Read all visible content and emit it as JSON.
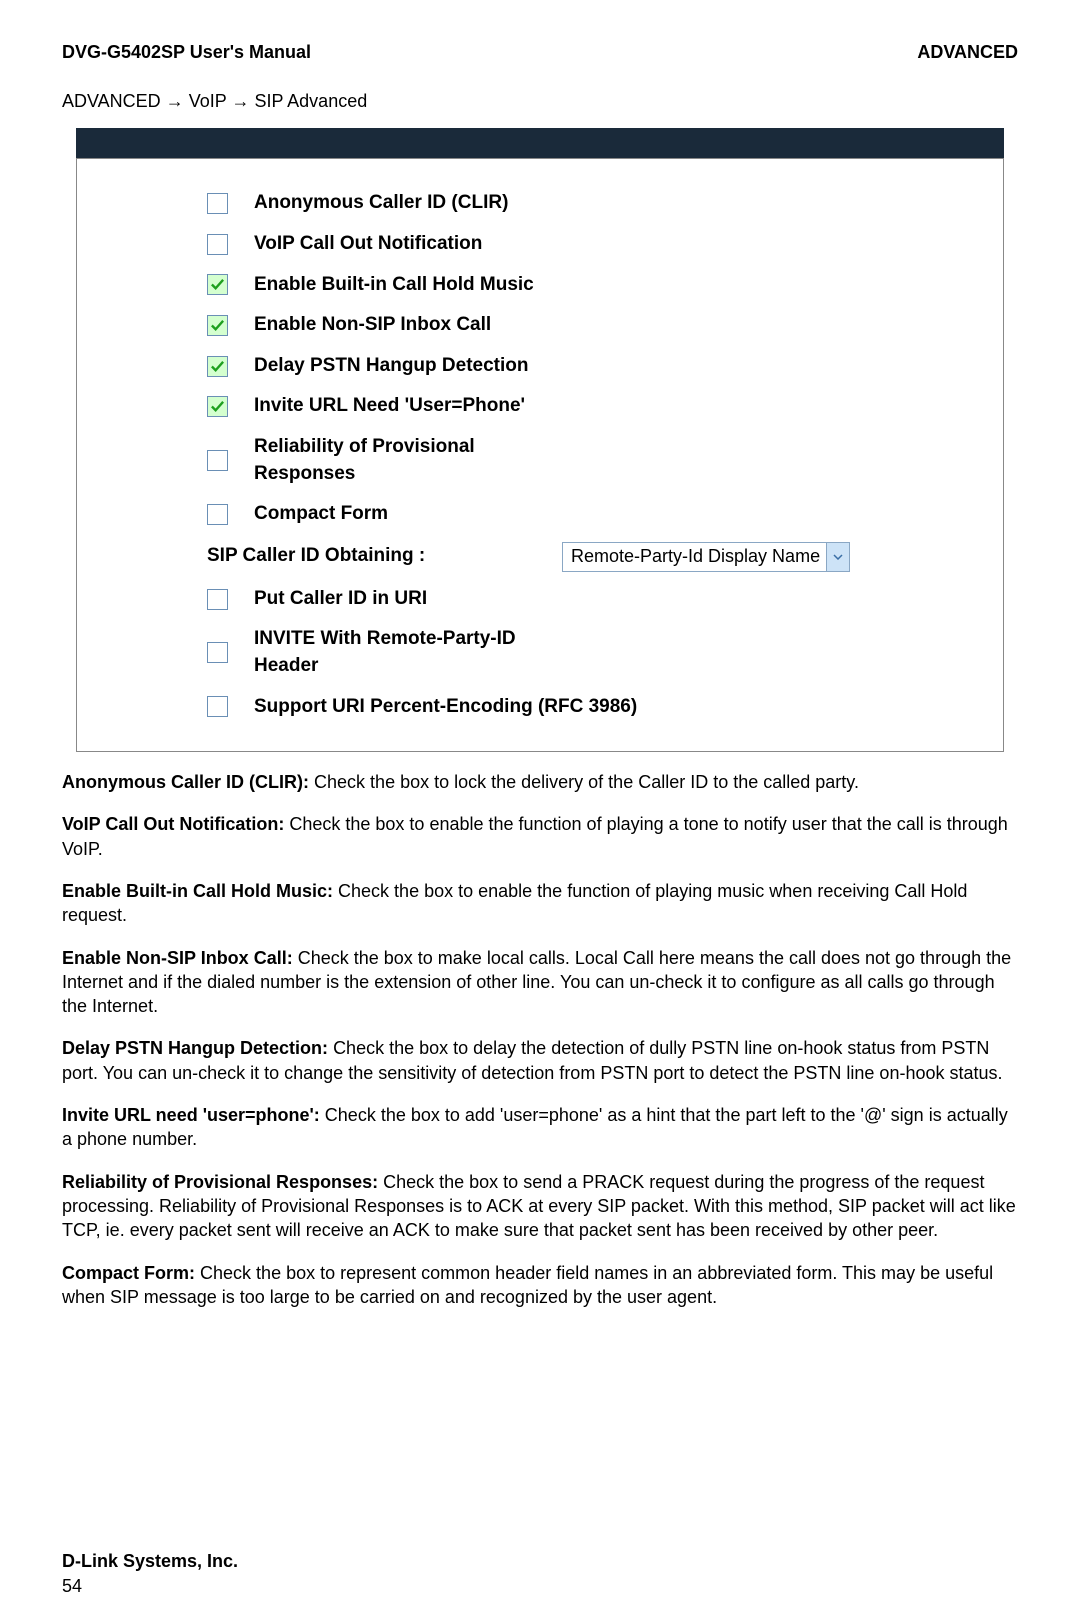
{
  "header": {
    "left": "DVG-G5402SP User's Manual",
    "right": "ADVANCED"
  },
  "crumb": {
    "a": "ADVANCED",
    "b": "VoIP",
    "c": "SIP Advanced"
  },
  "opts": [
    "Anonymous Caller ID (CLIR)",
    "VoIP Call Out Notification",
    "Enable Built-in Call Hold Music",
    "Enable Non-SIP Inbox Call",
    "Delay PSTN Hangup Detection",
    "Invite URL Need 'User=Phone'",
    "Reliability of Provisional Responses",
    "Compact Form",
    "Put Caller ID in URI",
    "INVITE With Remote-Party-ID Header",
    "Support URI Percent-Encoding (RFC 3986)"
  ],
  "selectRow": {
    "label": "SIP Caller ID Obtaining :",
    "value": "Remote-Party-Id Display Name"
  },
  "body": [
    {
      "t": "Anonymous Caller ID (CLIR):",
      "d": "Check the box to lock the delivery of the Caller ID to the called party."
    },
    {
      "t": "VoIP Call Out Notification:",
      "d": "Check the box to enable the function of playing a tone to notify user that the call is through VoIP."
    },
    {
      "t": "Enable Built-in Call Hold Music:",
      "d": "Check the box to enable the function of playing music when receiving Call Hold request."
    },
    {
      "t": "Enable Non-SIP Inbox Call:",
      "d": "Check the box to make local calls. Local Call here means the call does not go through the Internet and if the dialed number is the extension of other line. You can un-check it to configure as all calls go through the Internet."
    },
    {
      "t": "Delay PSTN Hangup Detection:",
      "d": "Check the box to delay the detection of dully PSTN line on-hook status from PSTN port. You can un-check it to change the sensitivity of detection from PSTN port to detect the PSTN line on-hook status."
    },
    {
      "t": "Invite URL need 'user=phone':",
      "d": "Check the box to add 'user=phone' as a hint that the part left to the '@' sign is actually a phone number."
    },
    {
      "t": "Reliability of Provisional Responses:",
      "d": "Check the box to send a PRACK request during the progress of the request processing. Reliability of Provisional Responses is to ACK at every SIP packet. With this method, SIP packet will act like TCP, ie. every packet sent will receive an ACK to make sure that packet sent has been received by other peer."
    },
    {
      "t": "Compact Form:",
      "d": "Check the box to represent common header field names in an abbreviated form. This may be useful when SIP message is too large to be carried on and recognized by the user agent."
    }
  ],
  "footer": {
    "company": "D-Link Systems, Inc.",
    "page": "54"
  }
}
